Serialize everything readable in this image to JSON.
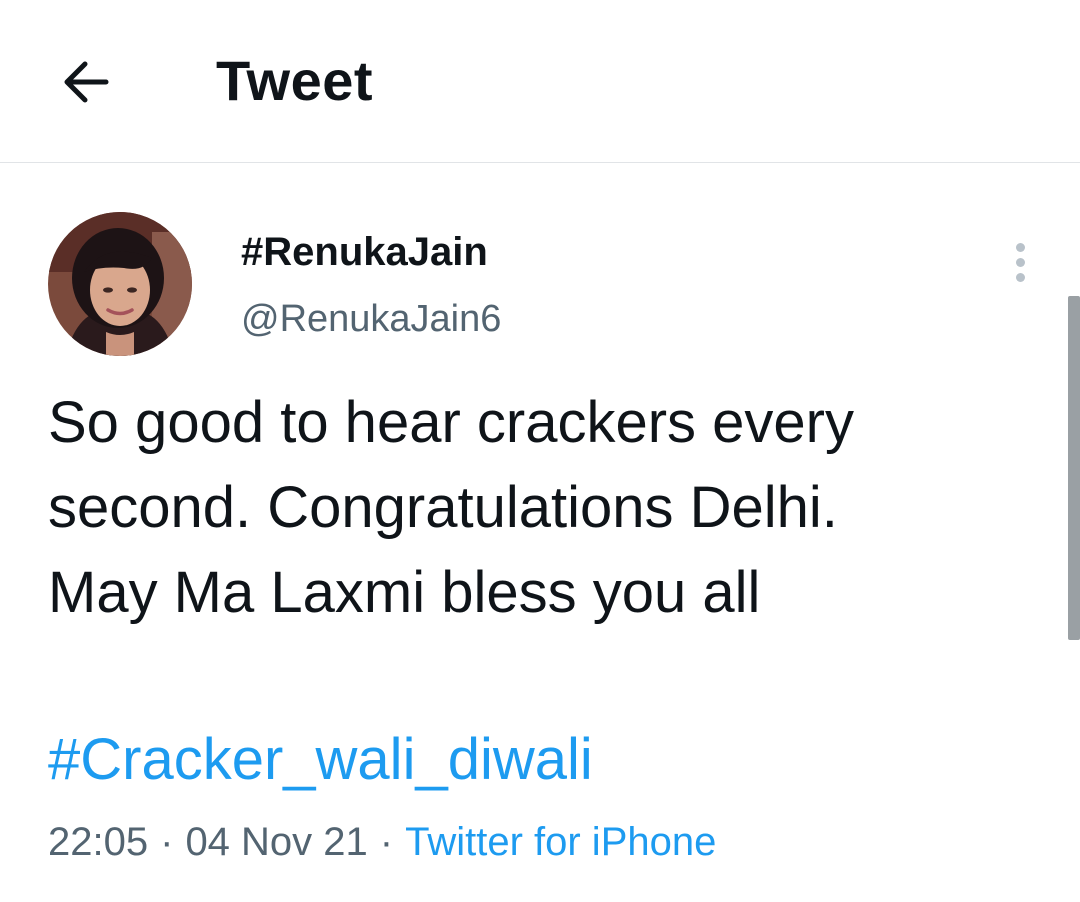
{
  "header": {
    "title": "Tweet",
    "back_icon": "arrow-left-icon"
  },
  "tweet": {
    "author": {
      "display_name": "#RenukaJain",
      "handle": "@RenukaJain6",
      "avatar_icon": "profile-photo"
    },
    "text": "So good to hear crackers every\nsecond. Congratulations Delhi.\nMay Ma Laxmi bless you all",
    "hashtag": "#Cracker_wali_diwali",
    "time": "22:05",
    "date": "04 Nov 21",
    "separator": "·",
    "source": "Twitter for iPhone",
    "more_icon": "vertical-dots-icon"
  },
  "colors": {
    "text": "#0f1419",
    "secondary": "#536471",
    "accent": "#1d9bf0",
    "divider": "#e1e4e7"
  }
}
